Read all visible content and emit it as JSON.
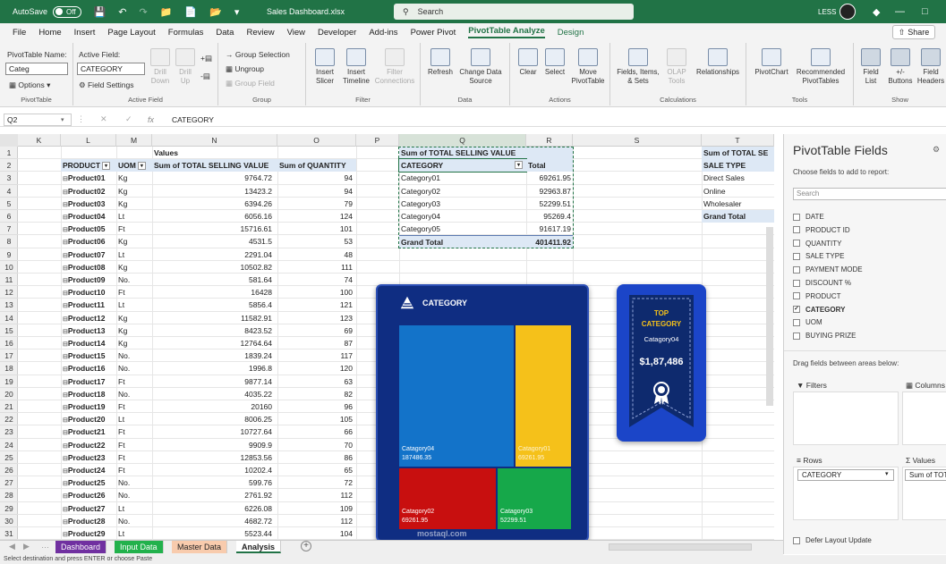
{
  "titlebar": {
    "autosave": "AutoSave",
    "toggle": "Off",
    "file_name": "Sales Dashboard.xlsx",
    "search_placeholder": "Search",
    "user": "LESS"
  },
  "menu": {
    "tabs": [
      "File",
      "Home",
      "Insert",
      "Page Layout",
      "Formulas",
      "Data",
      "Review",
      "View",
      "Developer",
      "Add-ins",
      "Power Pivot",
      "PivotTable Analyze",
      "Design"
    ],
    "active": "PivotTable Analyze",
    "share": "Share"
  },
  "ribbon": {
    "pivot_name_label": "PivotTable Name:",
    "pivot_name_value": "Categ",
    "options": "Options",
    "active_field_label": "Active Field:",
    "active_field_value": "CATEGORY",
    "field_settings": "Field Settings",
    "drill_down": "Drill Down",
    "drill_up": "Drill Up",
    "group_selection": "Group Selection",
    "ungroup": "Ungroup",
    "group_field": "Group Field",
    "insert_slicer": "Insert Slicer",
    "insert_timeline": "Insert Timeline",
    "filter_connections": "Filter Connections",
    "refresh": "Refresh",
    "change_source": "Change Data Source",
    "clear": "Clear",
    "select": "Select",
    "move_pivot": "Move PivotTable",
    "fields_items": "Fields, Items, & Sets",
    "olap_tools": "OLAP Tools",
    "relationships": "Relationships",
    "pivotchart": "PivotChart",
    "recommended": "Recommended PivotTables",
    "field_list": "Field List",
    "buttons": "+/- Buttons",
    "field_headers": "Field Headers",
    "groups": {
      "pivottable": "PivotTable",
      "active_field": "Active Field",
      "group": "Group",
      "filter": "Filter",
      "data": "Data",
      "actions": "Actions",
      "calculations": "Calculations",
      "tools": "Tools",
      "show": "Show"
    }
  },
  "formula": {
    "name_box": "Q2",
    "fx": "fx",
    "value": "CATEGORY"
  },
  "columns": [
    "K",
    "L",
    "M",
    "N",
    "O",
    "P",
    "Q",
    "R",
    "S",
    "T"
  ],
  "rows": [
    "1",
    "2",
    "3",
    "4",
    "5",
    "6",
    "7",
    "8",
    "9",
    "10",
    "11",
    "12",
    "13",
    "14",
    "15",
    "16",
    "17",
    "18",
    "19",
    "20",
    "21",
    "22",
    "23",
    "24",
    "25",
    "26",
    "27",
    "28",
    "29",
    "30",
    "31"
  ],
  "pivot1": {
    "values_label": "Values",
    "headers": [
      "PRODUCT",
      "UOM",
      "Sum of TOTAL SELLING VALUE",
      "Sum of QUANTITY"
    ],
    "rows": [
      [
        "Product01",
        "Kg",
        "9764.72",
        "94"
      ],
      [
        "Product02",
        "Kg",
        "13423.2",
        "94"
      ],
      [
        "Product03",
        "Kg",
        "6394.26",
        "79"
      ],
      [
        "Product04",
        "Lt",
        "6056.16",
        "124"
      ],
      [
        "Product05",
        "Ft",
        "15716.61",
        "101"
      ],
      [
        "Product06",
        "Kg",
        "4531.5",
        "53"
      ],
      [
        "Product07",
        "Lt",
        "2291.04",
        "48"
      ],
      [
        "Product08",
        "Kg",
        "10502.82",
        "111"
      ],
      [
        "Product09",
        "No.",
        "581.64",
        "74"
      ],
      [
        "Product10",
        "Ft",
        "16428",
        "100"
      ],
      [
        "Product11",
        "Lt",
        "5856.4",
        "121"
      ],
      [
        "Product12",
        "Kg",
        "11582.91",
        "123"
      ],
      [
        "Product13",
        "Kg",
        "8423.52",
        "69"
      ],
      [
        "Product14",
        "Kg",
        "12764.64",
        "87"
      ],
      [
        "Product15",
        "No.",
        "1839.24",
        "117"
      ],
      [
        "Product16",
        "No.",
        "1996.8",
        "120"
      ],
      [
        "Product17",
        "Ft",
        "9877.14",
        "63"
      ],
      [
        "Product18",
        "No.",
        "4035.22",
        "82"
      ],
      [
        "Product19",
        "Ft",
        "20160",
        "96"
      ],
      [
        "Product20",
        "Lt",
        "8006.25",
        "105"
      ],
      [
        "Product21",
        "Ft",
        "10727.64",
        "66"
      ],
      [
        "Product22",
        "Ft",
        "9909.9",
        "70"
      ],
      [
        "Product23",
        "Ft",
        "12853.56",
        "86"
      ],
      [
        "Product24",
        "Ft",
        "10202.4",
        "65"
      ],
      [
        "Product25",
        "No.",
        "599.76",
        "72"
      ],
      [
        "Product26",
        "No.",
        "2761.92",
        "112"
      ],
      [
        "Product27",
        "Lt",
        "6226.08",
        "109"
      ],
      [
        "Product28",
        "No.",
        "4682.72",
        "112"
      ],
      [
        "Product29",
        "Lt",
        "5523.44",
        "104"
      ]
    ]
  },
  "pivot2": {
    "value_header": "Sum of TOTAL SELLING VALUE",
    "headers": [
      "CATEGORY",
      "Total"
    ],
    "rows": [
      [
        "Category01",
        "69261.95"
      ],
      [
        "Category02",
        "92963.87"
      ],
      [
        "Category03",
        "52299.51"
      ],
      [
        "Category04",
        "95269.4"
      ],
      [
        "Category05",
        "91617.19"
      ]
    ],
    "grand": [
      "Grand Total",
      "401411.92"
    ]
  },
  "pivot3": {
    "header": "Sum of TOTAL SE",
    "row_label": "SALE TYPE",
    "rows": [
      "Direct Sales",
      "Online",
      "Wholesaler"
    ],
    "grand": "Grand Total"
  },
  "treemap": {
    "title": "CATEGORY",
    "tiles": [
      {
        "label": "Catagory04",
        "value": "187486.35",
        "color": "#1373c9"
      },
      {
        "label": "Catagory01",
        "value": "69261.95",
        "color": "#f5c11a"
      },
      {
        "label": "Catagory02",
        "value": "69261.95",
        "color": "#c80f0f"
      },
      {
        "label": "Catagory03",
        "value": "52299.51",
        "color": "#16a84a"
      }
    ]
  },
  "badge": {
    "top": "TOP",
    "category": "CATEGORY",
    "name": "Catagory04",
    "value": "$1,87,486"
  },
  "pane": {
    "title": "PivotTable Fields",
    "subtitle": "Choose fields to add to report:",
    "search": "Search",
    "fields": [
      {
        "name": "DATE",
        "checked": false
      },
      {
        "name": "PRODUCT ID",
        "checked": false
      },
      {
        "name": "QUANTITY",
        "checked": false
      },
      {
        "name": "SALE TYPE",
        "checked": false
      },
      {
        "name": "PAYMENT MODE",
        "checked": false
      },
      {
        "name": "DISCOUNT %",
        "checked": false
      },
      {
        "name": "PRODUCT",
        "checked": false
      },
      {
        "name": "CATEGORY",
        "checked": true
      },
      {
        "name": "UOM",
        "checked": false
      },
      {
        "name": "BUYING PRIZE",
        "checked": false
      }
    ],
    "drag_label": "Drag fields between areas below:",
    "filters": "Filters",
    "columns": "Columns",
    "rows": "Rows",
    "values": "Values",
    "rows_chip": "CATEGORY",
    "values_chip": "Sum of TOT",
    "defer": "Defer Layout Update"
  },
  "sheets": [
    {
      "name": "Dashboard",
      "color": "#7030a0",
      "text": "#fff"
    },
    {
      "name": "Input Data",
      "color": "#22b14c",
      "text": "#fff"
    },
    {
      "name": "Master Data",
      "color": "#f8cbad",
      "text": "#222"
    },
    {
      "name": "Analysis",
      "color": "#ffffff",
      "text": "#222"
    }
  ],
  "status": "Select destination and press ENTER or choose Paste",
  "watermark": "mostaql.com"
}
